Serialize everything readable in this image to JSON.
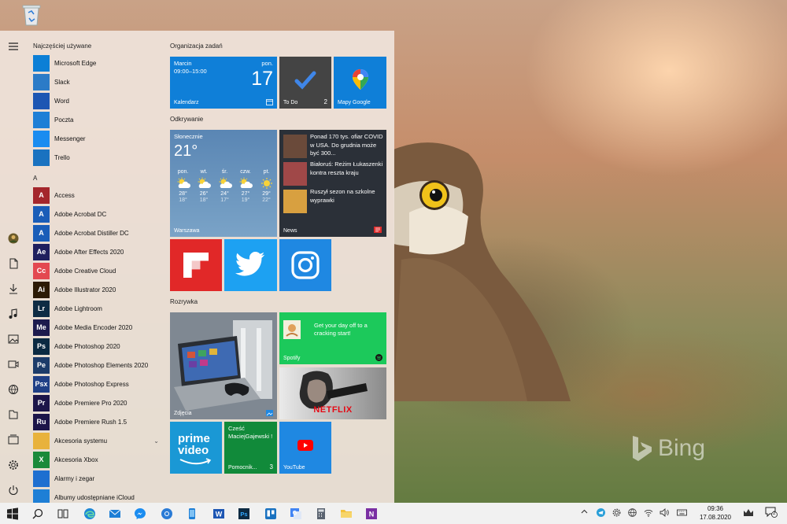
{
  "start_menu": {
    "most_used_header": "Najczęściej używane",
    "most_used": [
      {
        "label": "Microsoft Edge",
        "color": "#0c7fd6"
      },
      {
        "label": "Slack",
        "color": "#2b7bc7"
      },
      {
        "label": "Word",
        "color": "#1d56b3"
      },
      {
        "label": "Poczta",
        "color": "#1e7fd6"
      },
      {
        "label": "Messenger",
        "color": "#1a8cf0"
      },
      {
        "label": "Trello",
        "color": "#1a72c0"
      }
    ],
    "letter_a": "A",
    "apps_a": [
      {
        "label": "Access",
        "color": "#a4262c",
        "glyph": "A"
      },
      {
        "label": "Adobe Acrobat DC",
        "color": "#1a5db8",
        "glyph": "A"
      },
      {
        "label": "Adobe Acrobat Distiller DC",
        "color": "#1a5db8",
        "glyph": "A"
      },
      {
        "label": "Adobe After Effects 2020",
        "color": "#1f1f5e",
        "glyph": "Ae"
      },
      {
        "label": "Adobe Creative Cloud",
        "color": "#e34850",
        "glyph": "Cc"
      },
      {
        "label": "Adobe Illustrator 2020",
        "color": "#2c1a05",
        "glyph": "Ai"
      },
      {
        "label": "Adobe Lightroom",
        "color": "#0e2c44",
        "glyph": "Lr"
      },
      {
        "label": "Adobe Media Encoder 2020",
        "color": "#1d1b4e",
        "glyph": "Me"
      },
      {
        "label": "Adobe Photoshop 2020",
        "color": "#0b2a42",
        "glyph": "Ps"
      },
      {
        "label": "Adobe Photoshop Elements 2020",
        "color": "#1c3b6a",
        "glyph": "Pe"
      },
      {
        "label": "Adobe Photoshop Express",
        "color": "#1f3f86",
        "glyph": "Psx"
      },
      {
        "label": "Adobe Premiere Pro 2020",
        "color": "#1c1549",
        "glyph": "Pr"
      },
      {
        "label": "Adobe Premiere Rush 1.5",
        "color": "#1c1549",
        "glyph": "Ru"
      },
      {
        "label": "Akcesoria systemu",
        "color": "#e8b23c",
        "glyph": ""
      },
      {
        "label": "Akcesoria Xbox",
        "color": "#1a8a3a",
        "glyph": "X"
      },
      {
        "label": "Alarmy i zegar",
        "color": "#1e6fd0",
        "glyph": ""
      },
      {
        "label": "Albumy udostępniane iCloud",
        "color": "#1e7fd6",
        "glyph": ""
      }
    ],
    "groups": {
      "organize": "Organizacja zadań",
      "discover": "Odkrywanie",
      "fun": "Rozrywka"
    },
    "calendar": {
      "event": "Marcin",
      "time": "09:00–15:00",
      "day_name": "pon.",
      "day": "17",
      "name": "Kalendarz"
    },
    "todo": {
      "name": "To Do",
      "count": "2"
    },
    "maps": {
      "name": "Mapy Google"
    },
    "weather": {
      "condition": "Słonecznie",
      "temp": "21°",
      "city": "Warszawa",
      "days": [
        {
          "d": "pon.",
          "hi": "28°",
          "lo": "18°"
        },
        {
          "d": "wt.",
          "hi": "26°",
          "lo": "18°"
        },
        {
          "d": "śr.",
          "hi": "24°",
          "lo": "17°"
        },
        {
          "d": "czw.",
          "hi": "27°",
          "lo": "19°"
        },
        {
          "d": "pt.",
          "hi": "29°",
          "lo": "22°"
        }
      ]
    },
    "news": {
      "name": "News",
      "items": [
        "Ponad 170 tys. ofiar COVID w USA. Do grudnia może być 300...",
        "Białoruś: Reżim Łukaszenki kontra reszta kraju",
        "Ruszył sezon na szkolne wyprawki"
      ]
    },
    "photos": {
      "name": "Zdjęcia"
    },
    "spotify": {
      "name": "Spotify",
      "text": "Get your day off to a cracking start!"
    },
    "netflix": {
      "brand": "NETFLIX"
    },
    "prime": {
      "line1": "prime",
      "line2": "video"
    },
    "assistant": {
      "name": "Pomocnik...",
      "text": "Cześć MaciejGajewski !",
      "count": "3"
    },
    "youtube": {
      "name": "YouTube"
    }
  },
  "wallpaper": {
    "watermark": "Bing"
  },
  "taskbar": {
    "time": "09:36",
    "date": "17.08.2020",
    "notifications": "2"
  },
  "colors": {
    "tile_blue": "#0f7fd8",
    "todo_dark": "#444444",
    "news_dark": "#2b3038",
    "spotify_green": "#1cc95b",
    "assistant_green": "#118a3a",
    "youtube_blue": "#1f88e2",
    "twitter_blue": "#1da1f2",
    "instagram_blue": "#1f88e2",
    "flipboard_red": "#e12828",
    "prime_blue": "#1a98d5"
  }
}
